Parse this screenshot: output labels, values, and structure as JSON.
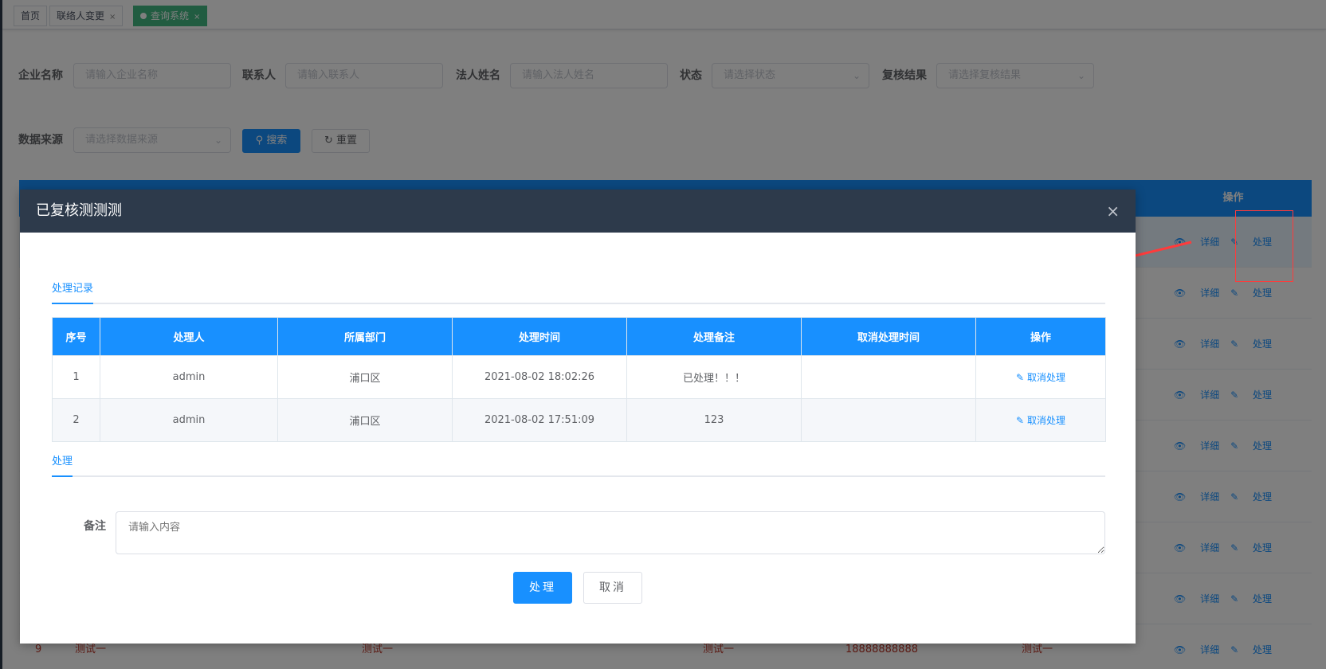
{
  "tags": [
    {
      "label": "首页",
      "closable": false,
      "active": false
    },
    {
      "label": "联络人变更",
      "closable": true,
      "active": false
    },
    {
      "label": "查询系统",
      "closable": true,
      "active": true
    }
  ],
  "filters": {
    "company_label": "企业名称",
    "company_placeholder": "请输入企业名称",
    "contact_label": "联系人",
    "contact_placeholder": "请输入联系人",
    "legal_label": "法人姓名",
    "legal_placeholder": "请输入法人姓名",
    "status_label": "状态",
    "status_placeholder": "请选择状态",
    "review_label": "复核结果",
    "review_placeholder": "请选择复核结果",
    "source_label": "数据来源",
    "source_placeholder": "请选择数据来源",
    "search_label": "搜索",
    "reset_label": "重置"
  },
  "bg_table": {
    "op_header": "操作",
    "detail_label": "详细",
    "handle_label": "处理",
    "last_row": {
      "index": "9",
      "col1": "测试一",
      "col2": "测试一",
      "col3": "测试一",
      "phone": "18888888888",
      "col5": "测试一"
    }
  },
  "modal": {
    "title": "已复核测测测",
    "close": "×",
    "records_tab": "处理记录",
    "columns": [
      "序号",
      "处理人",
      "所属部门",
      "处理时间",
      "处理备注",
      "取消处理时间",
      "操作"
    ],
    "rows": [
      {
        "index": "1",
        "handler": "admin",
        "dept": "浦口区",
        "time": "2021-08-02 18:02:26",
        "remark": "已处理！！！",
        "cancel_time": "",
        "action": "取消处理"
      },
      {
        "index": "2",
        "handler": "admin",
        "dept": "浦口区",
        "time": "2021-08-02 17:51:09",
        "remark": "123",
        "cancel_time": "",
        "action": "取消处理"
      }
    ],
    "handle_tab": "处理",
    "remark_label": "备注",
    "remark_placeholder": "请输入内容",
    "submit_label": "处理",
    "cancel_label": "取消"
  },
  "colors": {
    "primary": "#1890ff",
    "header_dark": "#2d3a4b",
    "tag_active": "#42b983",
    "annotation_red": "#ff3b3b"
  }
}
